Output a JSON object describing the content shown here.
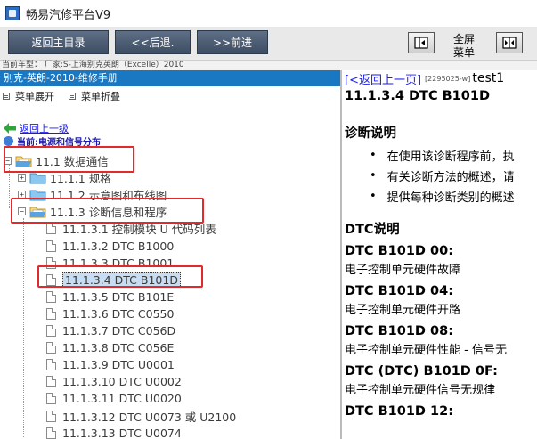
{
  "window": {
    "title": "畅易汽修平台V9"
  },
  "toolbar": {
    "home_label": "返回主目录",
    "back_label": "<<后退.",
    "forward_label": ">>前进",
    "fullscreen_label_1": "全屏",
    "fullscreen_label_2": "菜单"
  },
  "model_bar": {
    "text": "当前车型：  厂家:S-上海别克英朗（Excelle）2010"
  },
  "left": {
    "manual_title": "别克-英朗-2010-维修手册",
    "menu_expand": "菜单展开",
    "menu_collapse": "菜单折叠",
    "back_link": "返回上一级",
    "current_location": "当前:电源和信号分布",
    "tree": [
      {
        "label": "11.1 数据通信",
        "level": 0,
        "expander": "−",
        "icon": "open-folder-icon"
      },
      {
        "label": "11.1.1 规格",
        "level": 1,
        "expander": "+",
        "icon": "folder-icon"
      },
      {
        "label": "11.1.2 示意图和布线图",
        "level": 1,
        "expander": "+",
        "icon": "folder-icon"
      },
      {
        "label": "11.1.3 诊断信息和程序",
        "level": 1,
        "expander": "−",
        "icon": "open-folder-icon"
      },
      {
        "label": "11.1.3.1 控制模块 U 代码列表",
        "level": 2,
        "icon": "page-icon"
      },
      {
        "label": "11.1.3.2 DTC B1000",
        "level": 2,
        "icon": "page-icon"
      },
      {
        "label": "11.1.3.3 DTC B1001",
        "level": 2,
        "icon": "page-icon"
      },
      {
        "label": "11.1.3.4 DTC B101D",
        "level": 2,
        "icon": "page-icon",
        "selected": true
      },
      {
        "label": "11.1.3.5 DTC B101E",
        "level": 2,
        "icon": "page-icon"
      },
      {
        "label": "11.1.3.6 DTC C0550",
        "level": 2,
        "icon": "page-icon"
      },
      {
        "label": "11.1.3.7 DTC C056D",
        "level": 2,
        "icon": "page-icon"
      },
      {
        "label": "11.1.3.8 DTC C056E",
        "level": 2,
        "icon": "page-icon"
      },
      {
        "label": "11.1.3.9 DTC U0001",
        "level": 2,
        "icon": "page-icon"
      },
      {
        "label": "11.1.3.10 DTC U0002",
        "level": 2,
        "icon": "page-icon"
      },
      {
        "label": "11.1.3.11 DTC U0020",
        "level": 2,
        "icon": "page-icon"
      },
      {
        "label": "11.1.3.12 DTC U0073 或 U2100",
        "level": 2,
        "icon": "page-icon"
      },
      {
        "label": "11.1.3.13 DTC U0074",
        "level": 2,
        "icon": "page-icon"
      }
    ]
  },
  "right": {
    "back_link": "[<返回上一页]",
    "doc_code": "[2295025-w]",
    "doc_name": "test1",
    "doc_title": "11.1.3.4 DTC B101D",
    "diag_heading": "诊断说明",
    "bullets": [
      "在使用该诊断程序前，执",
      "有关诊断方法的概述，请",
      "提供每种诊断类别的概述"
    ],
    "dtc_heading": "DTC说明",
    "dtcs": [
      {
        "code": "DTC B101D 00:",
        "desc": "电子控制单元硬件故障"
      },
      {
        "code": "DTC B101D 04:",
        "desc": "电子控制单元硬件开路"
      },
      {
        "code": "DTC B101D 08:",
        "desc": "电子控制单元硬件性能 - 信号无"
      },
      {
        "code": "DTC (DTC) B101D 0F:",
        "desc": "电子控制单元硬件信号无规律"
      },
      {
        "code": "DTC B101D 12:",
        "desc": ""
      }
    ]
  },
  "colors": {
    "toolbar_button": "#4b5b72",
    "manual_header": "#1a78c2",
    "highlight_box": "#e22a2a",
    "link": "#1a1aee"
  }
}
